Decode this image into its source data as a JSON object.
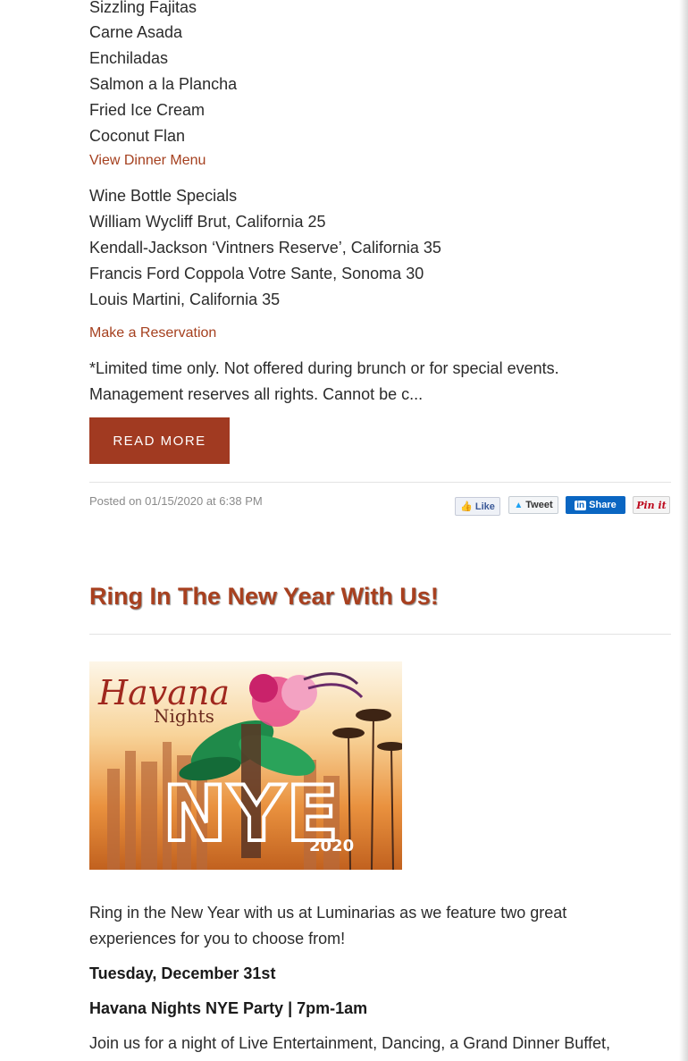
{
  "menu_items": [
    "Sizzling Fajitas",
    "Carne Asada",
    "Enchiladas",
    "Salmon a la Plancha",
    "Fried Ice Cream",
    "Coconut Flan"
  ],
  "dinner_link": "View Dinner Menu",
  "wine": {
    "heading": "Wine Bottle Specials",
    "items": [
      "William Wycliff Brut, California 25",
      "Kendall-Jackson ‘Vintners Reserve’, California 35",
      "Francis Ford Coppola Votre Sante, Sonoma 30",
      "Louis Martini, California 35"
    ]
  },
  "reservation_link": "Make a Reservation",
  "disclaimer": {
    "line1": "*Limited time only. Not offered during brunch or for special events.",
    "line2": "Management reserves all rights. Cannot be c..."
  },
  "read_more": "READ MORE",
  "posted": "Posted on 01/15/2020 at 6:38 PM",
  "social": {
    "like": "Like",
    "tweet": "Tweet",
    "linkedin_in": "in",
    "share": "Share",
    "pin": "Pin it"
  },
  "post2": {
    "title": "Ring In The New Year With Us!",
    "image": {
      "script_title": "Havana",
      "script_sub": "Nights",
      "big": "NYE",
      "year": "2020"
    },
    "intro_line1": "Ring in the New Year with us at Luminarias as we feature two great",
    "intro_line2": "experiences for you to choose from!",
    "date": "Tuesday, December 31st",
    "event": "Havana Nights NYE Party | 7pm-1am",
    "body_line1": "Join us for a night of Live Entertainment, Dancing, a Grand Dinner Buffet,"
  },
  "colors": {
    "accent": "#a5401f",
    "button": "#a13a21",
    "linkedin": "#0a66c2"
  }
}
